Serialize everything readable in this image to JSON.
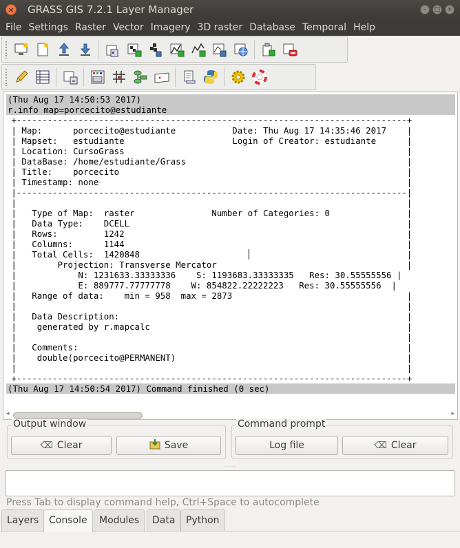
{
  "window": {
    "title": "GRASS GIS 7.2.1 Layer Manager"
  },
  "menu": [
    "File",
    "Settings",
    "Raster",
    "Vector",
    "Imagery",
    "3D raster",
    "Database",
    "Temporal",
    "Help"
  ],
  "toolbar1": [
    "new-display-icon",
    "new-workspace-icon",
    "load-workspace-icon",
    "save-workspace-icon",
    "add-raster-icon",
    "add-multiple-rasters-icon",
    "add-raster-misc-icon",
    "add-vector-icon",
    "add-multiple-vectors-icon",
    "add-vector-misc-icon",
    "add-web-service-icon",
    "add-group-icon",
    "remove-layer-icon"
  ],
  "toolbar2": [
    "vector-digitizer-icon",
    "attribute-table-icon",
    "map-calculator-icon",
    "cartographic-composer-icon",
    "georectifier-icon",
    "graphical-modeler-icon",
    "map-swipe-icon",
    "script-icon",
    "python-shell-icon",
    "settings-icon",
    "help-icon"
  ],
  "console": {
    "lines": [
      {
        "hl": true,
        "text": "(Thu Aug 17 14:50:53 2017)"
      },
      {
        "hl": true,
        "text": "r.info map=porcecito@estudiante"
      },
      {
        "hl": false,
        "text": " +----------------------------------------------------------------------------+"
      },
      {
        "hl": false,
        "text": " | Map:      porcecito@estudiante           Date: Thu Aug 17 14:35:46 2017    |"
      },
      {
        "hl": false,
        "text": " | Mapset:   estudiante                     Login of Creator: estudiante      |"
      },
      {
        "hl": false,
        "text": " | Location: CursoGrass                                                       |"
      },
      {
        "hl": false,
        "text": " | DataBase: /home/estudiante/Grass                                           |"
      },
      {
        "hl": false,
        "text": " | Title:    porcecito                                                        |"
      },
      {
        "hl": false,
        "text": " | Timestamp: none                                                            |"
      },
      {
        "hl": false,
        "text": " |----------------------------------------------------------------------------|"
      },
      {
        "hl": false,
        "text": " |                                                                            |"
      },
      {
        "hl": false,
        "text": " |   Type of Map:  raster               Number of Categories: 0               |"
      },
      {
        "hl": false,
        "text": " |   Data Type:    DCELL                                                      |"
      },
      {
        "hl": false,
        "text": " |   Rows:         1242                                                       |"
      },
      {
        "hl": false,
        "text": " |   Columns:      1144                                                       |"
      },
      {
        "hl": false,
        "text": " |   Total Cells:  1420848                                                    |"
      },
      {
        "hl": false,
        "text": " |        Projection: Transverse Mercator                                     |"
      },
      {
        "hl": false,
        "text": " |            N: 1231633.33333336    S: 1193683.33333335   Res: 30.55555556 |"
      },
      {
        "hl": false,
        "text": " |            E: 889777.77777778    W: 854822.22222223   Res: 30.55555556  |"
      },
      {
        "hl": false,
        "text": " |   Range of data:    min = 958  max = 2873                                  |"
      },
      {
        "hl": false,
        "text": " |                                                                            |"
      },
      {
        "hl": false,
        "text": " |   Data Description:                                                        |"
      },
      {
        "hl": false,
        "text": " |    generated by r.mapcalc                                                  |"
      },
      {
        "hl": false,
        "text": " |                                                                            |"
      },
      {
        "hl": false,
        "text": " |   Comments:                                                                |"
      },
      {
        "hl": false,
        "text": " |    double(porcecito@PERMANENT)                                             |"
      },
      {
        "hl": false,
        "text": " |                                                                            |"
      },
      {
        "hl": false,
        "text": " +----------------------------------------------------------------------------+"
      },
      {
        "hl": true,
        "text": "(Thu Aug 17 14:50:54 2017) Command finished (0 sec)"
      }
    ]
  },
  "output_window": {
    "label": "Output window",
    "clear": "Clear",
    "save": "Save"
  },
  "command_prompt": {
    "label": "Command prompt",
    "log_file": "Log file",
    "clear": "Clear"
  },
  "cmd_input": {
    "value": ""
  },
  "hint": "Press Tab to display command help, Ctrl+Space to autocomplete",
  "tabs": [
    "Layers",
    "Console",
    "Modules",
    "Data",
    "Python"
  ],
  "active_tab": "Console",
  "colors": {
    "titlebar": "#3c3b37",
    "highlight": "#c8c8c8",
    "close": "#f07746"
  }
}
